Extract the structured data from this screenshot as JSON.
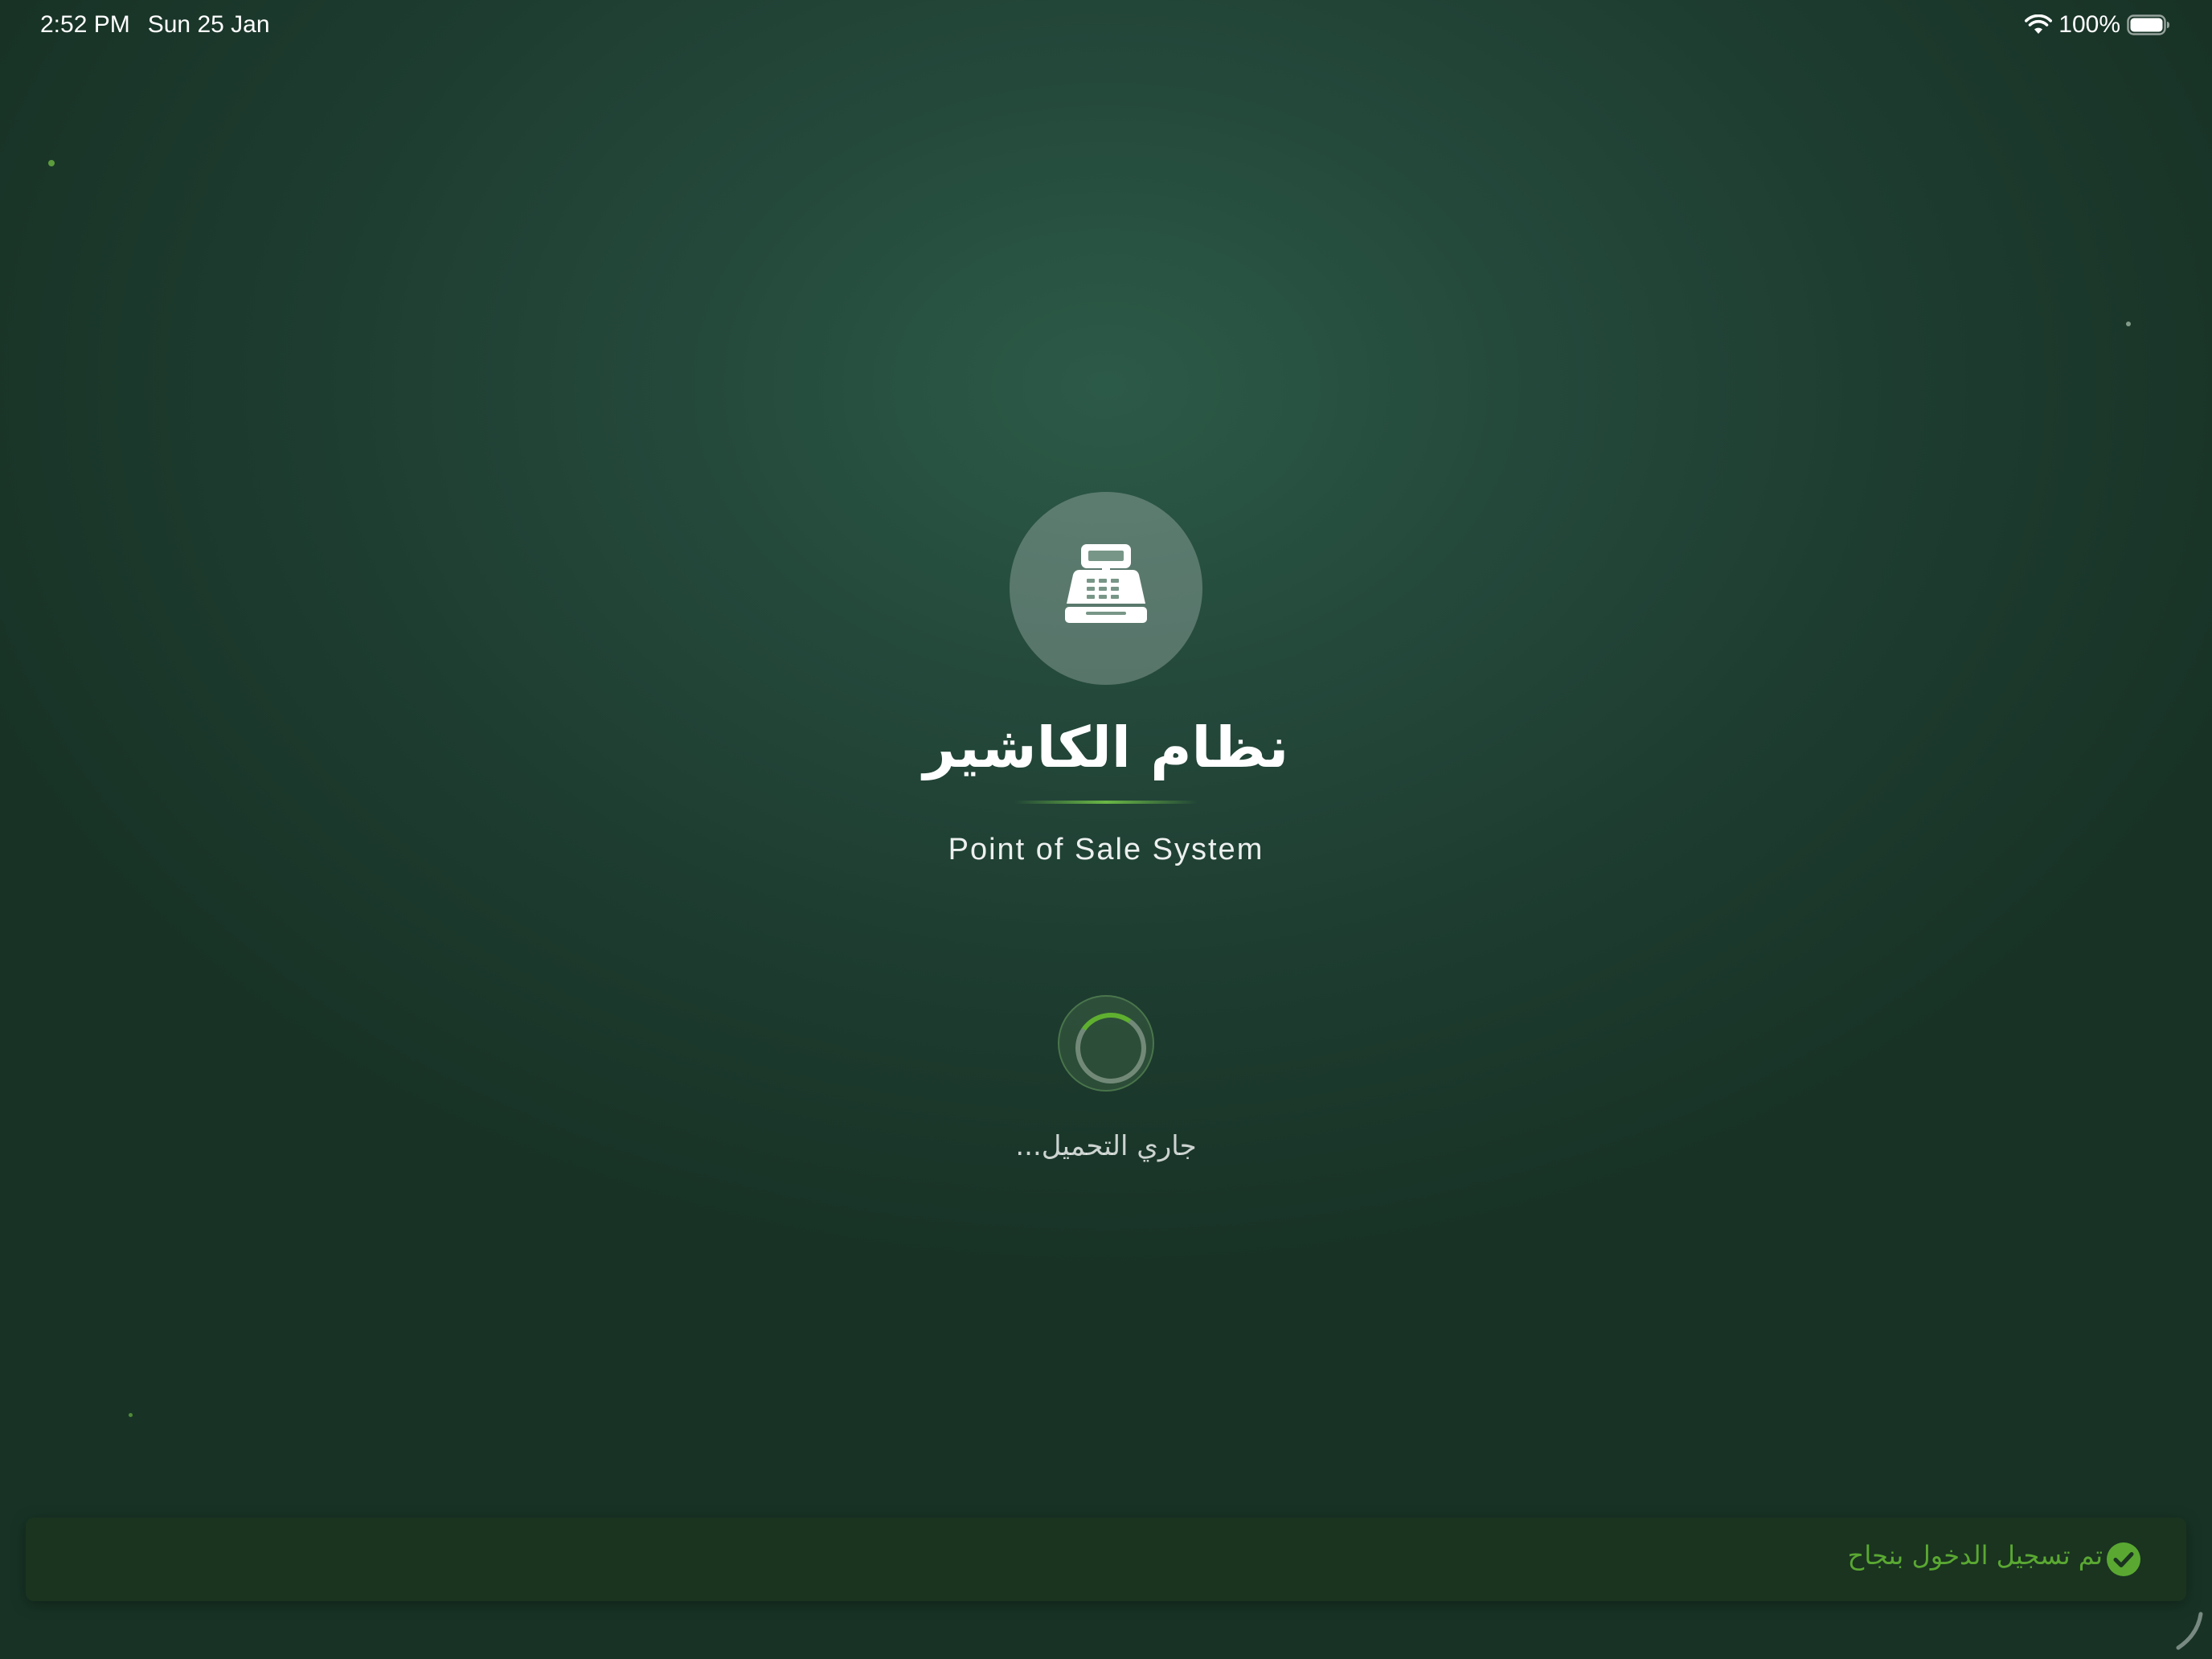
{
  "status_bar": {
    "time": "2:52 PM",
    "date": "Sun 25 Jan",
    "battery": "100%",
    "wifi_icon": "wifi-icon",
    "battery_icon": "battery-icon"
  },
  "splash": {
    "logo_icon": "cash-register-icon",
    "title": "نظام الكاشير",
    "subtitle": "Point of Sale System",
    "loading_text": "جاري التحميل..."
  },
  "toast": {
    "message": "تم تسجيل الدخول بنجاح",
    "icon": "check-circle-icon",
    "accent_color": "#5aa832"
  },
  "colors": {
    "background": "#24493b",
    "accent": "#5fb02f"
  }
}
